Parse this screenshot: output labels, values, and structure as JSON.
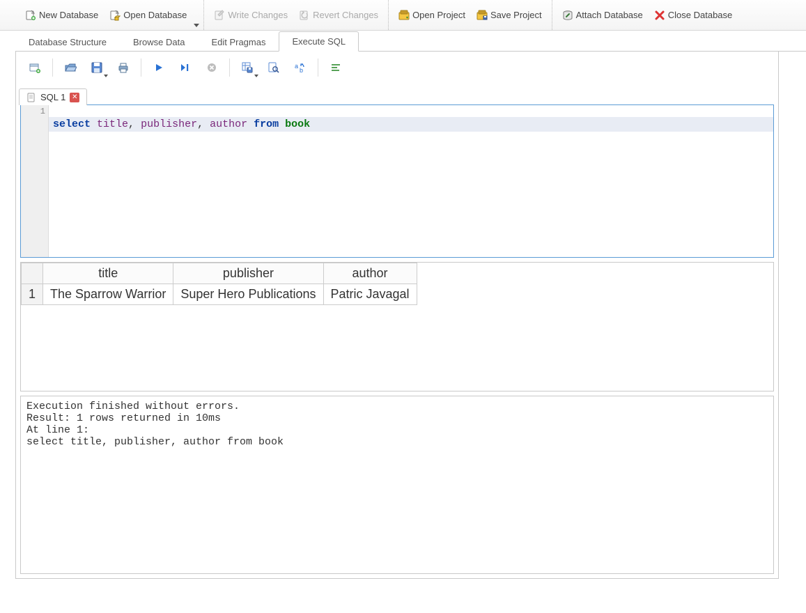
{
  "toolbar": {
    "new_database": "New Database",
    "open_database": "Open Database",
    "write_changes": "Write Changes",
    "revert_changes": "Revert Changes",
    "open_project": "Open Project",
    "save_project": "Save Project",
    "attach_database": "Attach Database",
    "close_database": "Close Database"
  },
  "view_tabs": {
    "structure": "Database Structure",
    "browse": "Browse Data",
    "pragmas": "Edit Pragmas",
    "execute": "Execute SQL"
  },
  "sql_tab": {
    "label": "SQL 1"
  },
  "editor": {
    "line_number": "1",
    "tokens": {
      "select": "select",
      "title": "title",
      "comma1": ", ",
      "publisher": "publisher",
      "comma2": ", ",
      "author": "author",
      "from": "from",
      "book": "book"
    }
  },
  "results": {
    "headers": [
      "title",
      "publisher",
      "author"
    ],
    "rows": [
      {
        "n": "1",
        "cells": [
          "The Sparrow Warrior",
          "Super Hero Publications",
          "Patric Javagal"
        ]
      }
    ]
  },
  "log": "Execution finished without errors.\nResult: 1 rows returned in 10ms\nAt line 1:\nselect title, publisher, author from book"
}
